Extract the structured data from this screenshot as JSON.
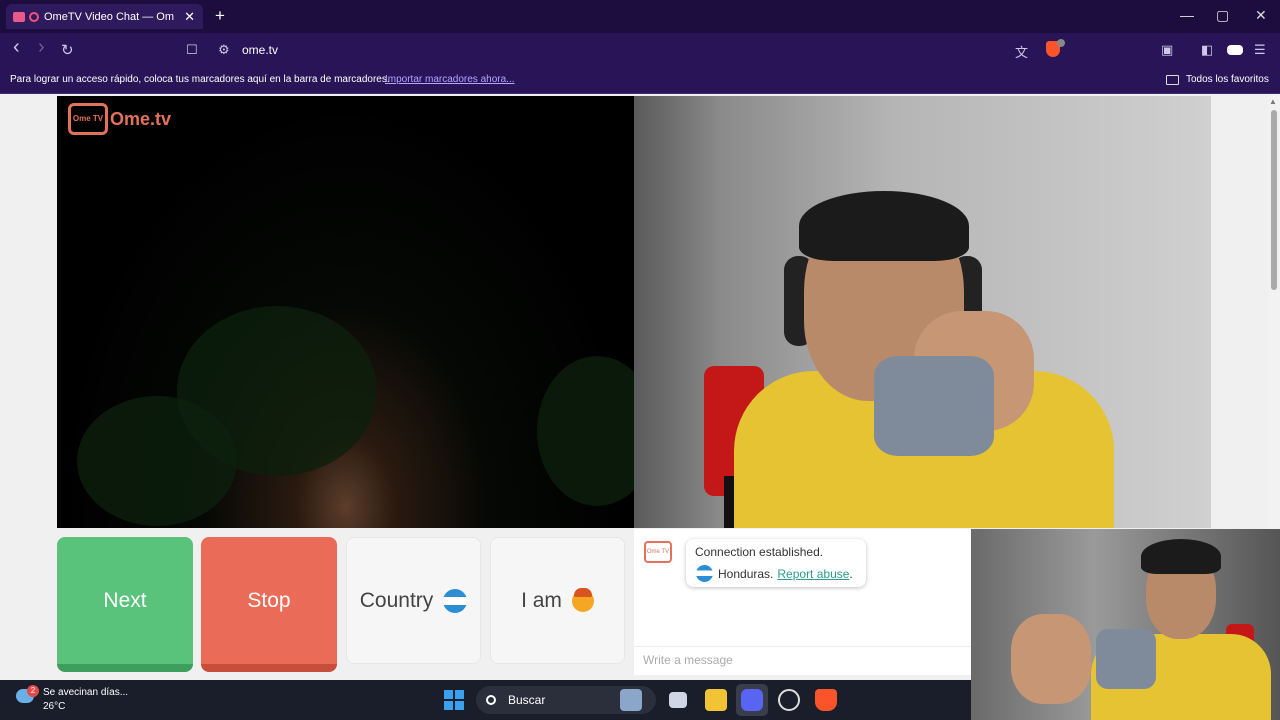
{
  "browser": {
    "tab_title": "OmeTV Video Chat — Omegl",
    "tab_close": "✕",
    "new_tab": "+",
    "url": "ome.tv",
    "window_controls": {
      "minimize": "—",
      "maximize": "▢",
      "close": "✕"
    },
    "nav": {
      "back": "‹",
      "forward": "›",
      "reload": "↻"
    },
    "bookmark_bar": {
      "message": "Para lograr un acceso rápido, coloca tus marcadores aquí en la barra de marcadores.",
      "import_link": "Importar marcadores ahora...",
      "all_favorites": "Todos los favoritos"
    },
    "accent_color": "#2a1458"
  },
  "page": {
    "logo_text": "Ome.tv",
    "logo_badge": "Ome TV",
    "buttons": {
      "next": "Next",
      "stop": "Stop",
      "country": "Country",
      "i_am": "I am"
    },
    "chat": {
      "system_line1": "Connection established.",
      "country": "Honduras.",
      "report": "Report abuse",
      "report_suffix": ".",
      "input_placeholder": "Write a message"
    },
    "colors": {
      "next": "#5ac37b",
      "stop": "#ea6c58",
      "logo": "#e2725b",
      "link": "#2a9d8f"
    }
  },
  "taskbar": {
    "weather_text": "Se avecinan días...",
    "weather_temp": "26°C",
    "weather_badge": "2",
    "search_label": "Buscar",
    "icons": [
      "windows-start-icon",
      "search-icon",
      "widget-icon",
      "task-view-icon",
      "file-explorer-icon",
      "discord-icon",
      "chatgpt-icon",
      "brave-icon"
    ]
  }
}
